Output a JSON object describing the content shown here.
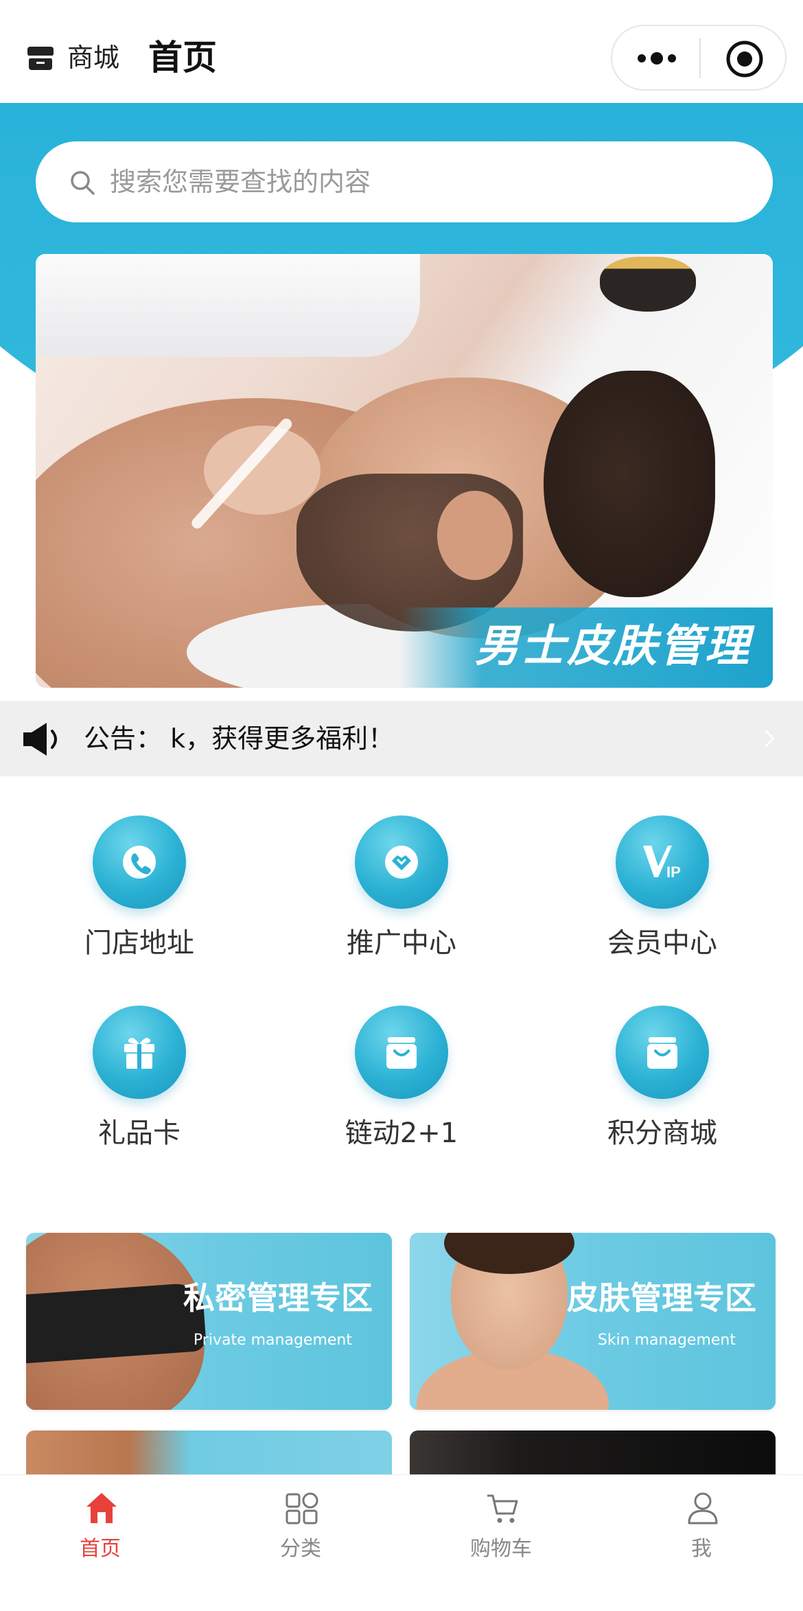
{
  "header": {
    "store_label": "商城",
    "page_title": "首页"
  },
  "search": {
    "placeholder": "搜索您需要查找的内容"
  },
  "banner": {
    "text": "男士皮肤管理"
  },
  "notice": {
    "text": "公告：  k，获得更多福利！"
  },
  "shortcuts": [
    {
      "label": "门店地址",
      "icon": "phone-icon"
    },
    {
      "label": "推广中心",
      "icon": "handshake-icon"
    },
    {
      "label": "会员中心",
      "icon": "vip-icon"
    },
    {
      "label": "礼品卡",
      "icon": "gift-icon"
    },
    {
      "label": "链动2+1",
      "icon": "shopping-bag-icon"
    },
    {
      "label": "积分商城",
      "icon": "shopping-bag-icon"
    }
  ],
  "cards": [
    {
      "title": "私密管理专区",
      "subtitle": "Private management"
    },
    {
      "title": "皮肤管理专区",
      "subtitle": "Skin management"
    }
  ],
  "tabbar": [
    {
      "label": "首页",
      "icon": "home-icon",
      "active": true
    },
    {
      "label": "分类",
      "icon": "category-icon",
      "active": false
    },
    {
      "label": "购物车",
      "icon": "cart-icon",
      "active": false
    },
    {
      "label": "我",
      "icon": "user-icon",
      "active": false
    }
  ],
  "colors": {
    "brand_blue": "#1eaad4",
    "active_red": "#e8413c"
  }
}
